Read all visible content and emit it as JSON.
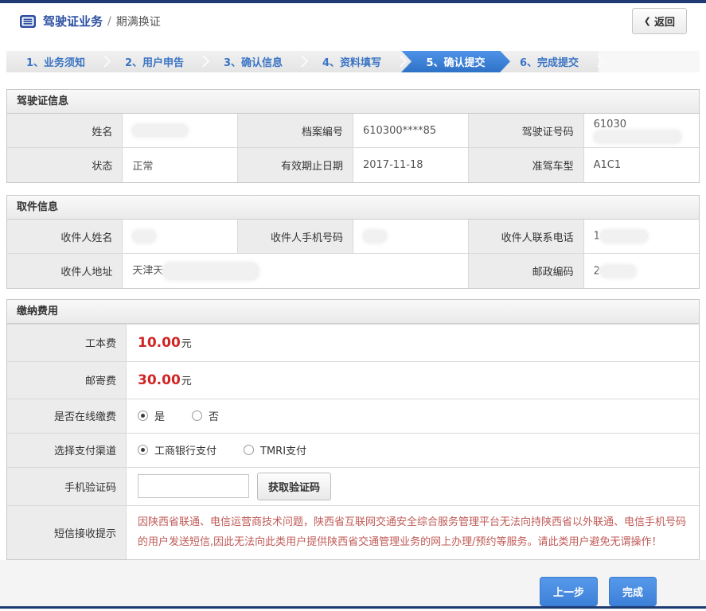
{
  "header": {
    "title": "驾驶证业务",
    "divider": "/",
    "subtitle": "期满换证",
    "back_chevron": "❮",
    "back_button": "返回"
  },
  "steps": [
    {
      "label": "1、业务须知",
      "active": false
    },
    {
      "label": "2、用户申告",
      "active": false
    },
    {
      "label": "3、确认信息",
      "active": false
    },
    {
      "label": "4、资料填写",
      "active": false
    },
    {
      "label": "5、确认提交",
      "active": true
    },
    {
      "label": "6、完成提交",
      "active": false
    }
  ],
  "license_info": {
    "title": "驾驶证信息",
    "name_label": "姓名",
    "file_number_label": "档案编号",
    "file_number_value": "610300****85",
    "license_number_label": "驾驶证号码",
    "license_number_value_prefix": "61030",
    "status_label": "状态",
    "status_value": "正常",
    "expiry_label": "有效期止日期",
    "expiry_value": "2017-11-18",
    "vehicle_class_label": "准驾车型",
    "vehicle_class_value": "A1C1"
  },
  "pickup_info": {
    "title": "取件信息",
    "recipient_name_label": "收件人姓名",
    "recipient_mobile_label": "收件人手机号码",
    "recipient_phone_label": "收件人联系电话",
    "recipient_phone_value_prefix": "1",
    "recipient_address_label": "收件人地址",
    "recipient_address_value_prefix": "天津天",
    "zip_code_label": "邮政编码",
    "zip_code_value_prefix": "2"
  },
  "payment": {
    "title": "缴纳费用",
    "production_fee_label": "工本费",
    "production_fee_value": "10.00",
    "production_fee_unit": "元",
    "postage_fee_label": "邮寄费",
    "postage_fee_value": "30.00",
    "postage_fee_unit": "元",
    "online_payment_label": "是否在线缴费",
    "online_payment_options": [
      {
        "label": "是",
        "selected": true
      },
      {
        "label": "否",
        "selected": false
      }
    ],
    "channel_label": "选择支付渠道",
    "channel_options": [
      {
        "label": "工商银行支付",
        "selected": true
      },
      {
        "label": "TMRI支付",
        "selected": false
      }
    ],
    "sms_code_label": "手机验证码",
    "sms_code_value": "",
    "get_code_button": "获取验证码",
    "sms_notice_label": "短信接收提示",
    "sms_notice_text": "因陕西省联通、电信运营商技术问题，陕西省互联网交通安全综合服务管理平台无法向持陕西省以外联通、电信手机号码的用户发送短信,因此无法向此类用户提供陕西省交通管理业务的网上办理/预约等服务。请此类用户避免无谓操作！"
  },
  "footer": {
    "prev_button": "上一步",
    "finish_button": "完成"
  },
  "colors": {
    "navy": "#1e3a73",
    "title_blue": "#2b4fa2",
    "step_blue": "#3a74c4",
    "active_step_blue": "#3c80d9",
    "action_blue": "#4a90e2",
    "fee_red": "#d02525",
    "notice_red": "#bf5a56"
  }
}
